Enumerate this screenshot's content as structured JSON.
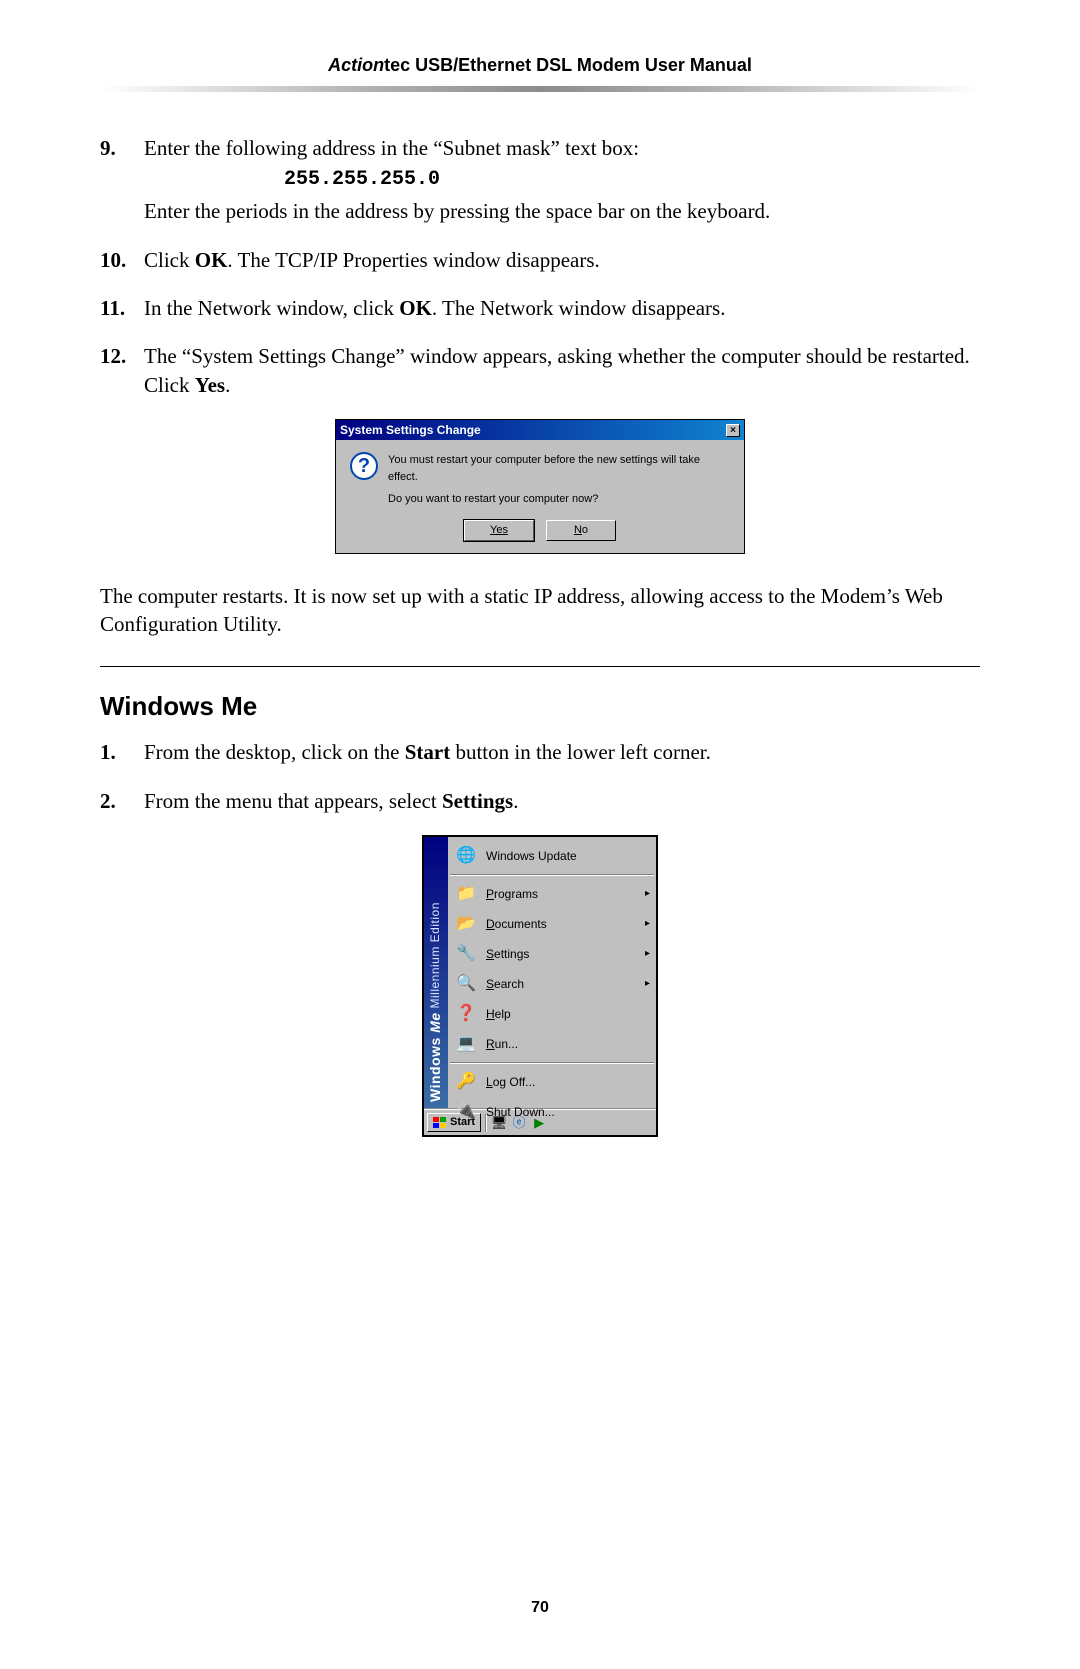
{
  "header": {
    "brand": "Action",
    "brandSuffix": "tec",
    "titleRest": " USB/Ethernet DSL Modem User Manual"
  },
  "steps": [
    {
      "num": "9.",
      "line1": "Enter the following address in the “Subnet mask” text box:",
      "mono": "255.255.255.0",
      "line2": "Enter the periods in the address by pressing the space bar on the keyboard."
    },
    {
      "num": "10.",
      "prefix": "Click ",
      "bold1": "OK",
      "mid": ". The ",
      "sc": "TCP/IP",
      "suffix": " Properties window disappears."
    },
    {
      "num": "11.",
      "prefix": "In the Network window, click ",
      "bold1": "OK",
      "suffix": ". The Network window disappears."
    },
    {
      "num": "12.",
      "prefix": "The “System Settings Change” window appears, asking whether the computer should be restarted. Click ",
      "bold1": "Yes",
      "suffix": "."
    }
  ],
  "dialog": {
    "title": "System Settings Change",
    "line1": "You must restart your computer before the new settings will take effect.",
    "line2": "Do you want to restart your computer now?",
    "yes": "Yes",
    "no": "No"
  },
  "afterDialog": {
    "t1": "The computer restarts. It is now set up with a static ",
    "sc": "IP",
    "t2": " address, allowing access to the Modem’s Web Configuration Utility."
  },
  "sectionHeading": "Windows Me",
  "meSteps": [
    {
      "num": "1.",
      "prefix": "From the desktop, click on the ",
      "bold": "Start",
      "suffix": " button in the lower left corner."
    },
    {
      "num": "2.",
      "prefix": "From the menu that appears, select ",
      "bold": "Settings",
      "suffix": "."
    }
  ],
  "startMenu": {
    "bannerBold": "Windows",
    "bannerItalic": "Me",
    "bannerLight": " Millennium Edition",
    "items": [
      {
        "icon": "🌐",
        "label": "Windows Update",
        "u": "",
        "arrow": false,
        "sepAfter": true
      },
      {
        "icon": "📁",
        "label": "Programs",
        "u": "P",
        "arrow": true
      },
      {
        "icon": "📂",
        "label": "Documents",
        "u": "D",
        "arrow": true
      },
      {
        "icon": "🔧",
        "label": "Settings",
        "u": "S",
        "arrow": true
      },
      {
        "icon": "🔍",
        "label": "Search",
        "u": "S",
        "arrow": true
      },
      {
        "icon": "❓",
        "label": "Help",
        "u": "H",
        "arrow": false
      },
      {
        "icon": "💻",
        "label": "Run...",
        "u": "R",
        "arrow": false,
        "sepAfter": true
      },
      {
        "icon": "🔑",
        "label": "Log Off...",
        "u": "L",
        "arrow": false
      },
      {
        "icon": "🔌",
        "label": "Shut Down...",
        "u": "",
        "arrow": false
      }
    ],
    "startLabel": "Start"
  },
  "pageNumber": "70"
}
